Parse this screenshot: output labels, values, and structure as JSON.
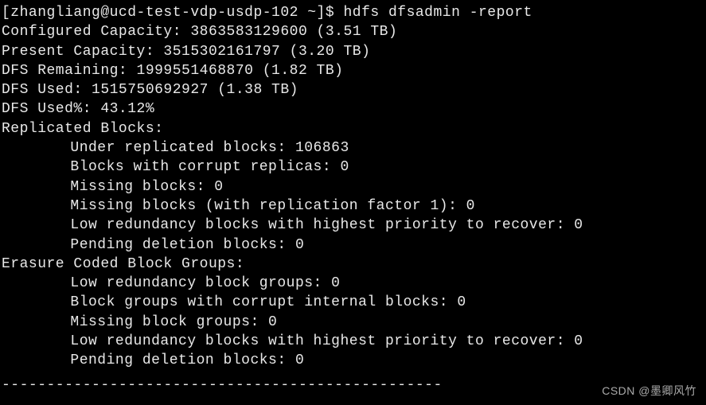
{
  "prompt": {
    "user_host": "[zhangliang@ucd-test-vdp-usdp-102 ~]$ ",
    "command": "hdfs dfsadmin -report"
  },
  "summary": {
    "configured_capacity": "Configured Capacity: 3863583129600 (3.51 TB)",
    "present_capacity": "Present Capacity: 3515302161797 (3.20 TB)",
    "dfs_remaining": "DFS Remaining: 1999551468870 (1.82 TB)",
    "dfs_used": "DFS Used: 1515750692927 (1.38 TB)",
    "dfs_used_pct": "DFS Used%: 43.12%"
  },
  "replicated": {
    "header": "Replicated Blocks:",
    "under_replicated": "Under replicated blocks: 106863",
    "corrupt_replicas": "Blocks with corrupt replicas: 0",
    "missing": "Missing blocks: 0",
    "missing_rf1": "Missing blocks (with replication factor 1): 0",
    "low_redundancy_priority": "Low redundancy blocks with highest priority to recover: 0",
    "pending_deletion": "Pending deletion blocks: 0"
  },
  "erasure": {
    "header": "Erasure Coded Block Groups:",
    "low_redundancy_groups": "Low redundancy block groups: 0",
    "corrupt_internal": "Block groups with corrupt internal blocks: 0",
    "missing_groups": "Missing block groups: 0",
    "low_redundancy_priority": "Low redundancy blocks with highest priority to recover: 0",
    "pending_deletion": "Pending deletion blocks: 0"
  },
  "divider": "-------------------------------------------------",
  "watermark": "CSDN @墨卿风竹"
}
